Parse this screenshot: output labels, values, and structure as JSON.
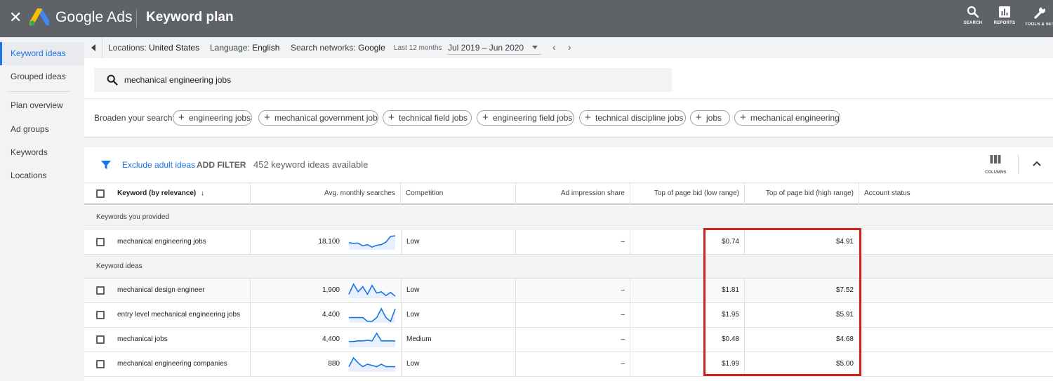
{
  "header": {
    "close_glyph": "✕",
    "brand": "Google Ads",
    "title": "Keyword plan",
    "tools": [
      {
        "label": "SEARCH",
        "icon": "search-icon"
      },
      {
        "label": "REPORTS",
        "icon": "reports-icon"
      },
      {
        "label": "TOOLS & SETTINGS",
        "icon": "wrench-icon"
      }
    ]
  },
  "sidebar": {
    "items": [
      {
        "label": "Keyword ideas",
        "active": true
      },
      {
        "label": "Grouped ideas"
      },
      {
        "label": "Plan overview"
      },
      {
        "label": "Ad groups"
      },
      {
        "label": "Keywords"
      },
      {
        "label": "Locations"
      }
    ]
  },
  "filters": {
    "locations_label": "Locations:",
    "locations_value": "United States",
    "language_label": "Language:",
    "language_value": "English",
    "networks_label": "Search networks:",
    "networks_value": "Google",
    "period_label": "Last 12 months",
    "period_value": "Jul 2019 – Jun 2020",
    "prev": "‹",
    "next": "›"
  },
  "search": {
    "query": "mechanical engineering jobs",
    "broaden_label": "Broaden your search:",
    "chips": [
      "engineering jobs",
      "mechanical government job",
      "technical field jobs",
      "engineering field jobs",
      "technical discipline jobs",
      "jobs",
      "mechanical engineering"
    ]
  },
  "toolbar": {
    "exclude_adult": "Exclude adult ideas",
    "add_filter": "ADD FILTER",
    "available": "452 keyword ideas available",
    "columns_label": "COLUMNS"
  },
  "table": {
    "headers": {
      "keyword": "Keyword (by relevance)",
      "sort": "↓",
      "avg_searches": "Avg. monthly searches",
      "competition": "Competition",
      "ad_share": "Ad impression share",
      "bid_low": "Top of page bid (low range)",
      "bid_high": "Top of page bid (high range)",
      "status": "Account status"
    },
    "section_provided": "Keywords you provided",
    "section_ideas": "Keyword ideas",
    "provided": [
      {
        "keyword": "mechanical engineering jobs",
        "searches": "18,100",
        "competition": "Low",
        "share": "–",
        "low": "$0.74",
        "high": "$4.91",
        "trend": [
          0.45,
          0.4,
          0.42,
          0.2,
          0.3,
          0.1,
          0.25,
          0.3,
          0.5,
          0.95,
          1.0
        ]
      }
    ],
    "ideas": [
      {
        "keyword": "mechanical design engineer",
        "searches": "1,900",
        "competition": "Low",
        "share": "–",
        "low": "$1.81",
        "high": "$7.52",
        "trend": [
          0.2,
          1.0,
          0.4,
          0.8,
          0.2,
          0.9,
          0.3,
          0.4,
          0.1,
          0.35,
          0.05
        ]
      },
      {
        "keyword": "entry level mechanical engineering jobs",
        "searches": "4,400",
        "competition": "Low",
        "share": "–",
        "low": "$1.95",
        "high": "$5.91",
        "trend": [
          0.3,
          0.3,
          0.3,
          0.3,
          0.0,
          0.0,
          0.3,
          1.0,
          0.3,
          0.0,
          1.0
        ]
      },
      {
        "keyword": "mechanical jobs",
        "searches": "4,400",
        "competition": "Medium",
        "share": "–",
        "low": "$0.48",
        "high": "$4.68",
        "trend": [
          0.35,
          0.35,
          0.4,
          0.4,
          0.45,
          0.4,
          1.0,
          0.4,
          0.4,
          0.4,
          0.4
        ]
      },
      {
        "keyword": "mechanical engineering companies",
        "searches": "880",
        "competition": "Low",
        "share": "–",
        "low": "$1.99",
        "high": "$5.00",
        "trend": [
          0.3,
          1.0,
          0.6,
          0.3,
          0.5,
          0.4,
          0.3,
          0.5,
          0.3,
          0.3,
          0.3
        ]
      }
    ]
  },
  "colors": {
    "accent": "#1a73e8",
    "highlight": "#d0201a",
    "topbar": "#5f6368"
  }
}
